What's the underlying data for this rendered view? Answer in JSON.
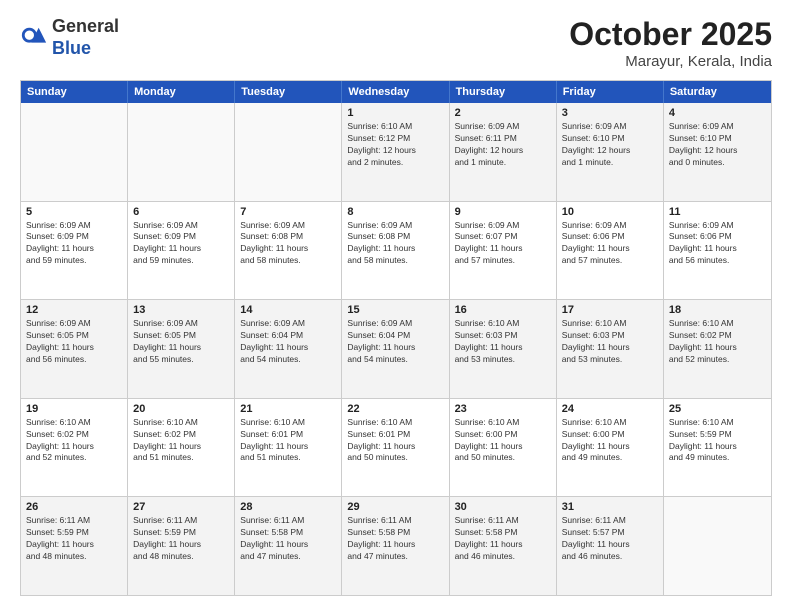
{
  "header": {
    "logo_general": "General",
    "logo_blue": "Blue",
    "month_title": "October 2025",
    "location": "Marayur, Kerala, India"
  },
  "days_of_week": [
    "Sunday",
    "Monday",
    "Tuesday",
    "Wednesday",
    "Thursday",
    "Friday",
    "Saturday"
  ],
  "weeks": [
    [
      {
        "day": "",
        "info": "",
        "empty": true
      },
      {
        "day": "",
        "info": "",
        "empty": true
      },
      {
        "day": "",
        "info": "",
        "empty": true
      },
      {
        "day": "1",
        "info": "Sunrise: 6:10 AM\nSunset: 6:12 PM\nDaylight: 12 hours\nand 2 minutes."
      },
      {
        "day": "2",
        "info": "Sunrise: 6:09 AM\nSunset: 6:11 PM\nDaylight: 12 hours\nand 1 minute."
      },
      {
        "day": "3",
        "info": "Sunrise: 6:09 AM\nSunset: 6:10 PM\nDaylight: 12 hours\nand 1 minute."
      },
      {
        "day": "4",
        "info": "Sunrise: 6:09 AM\nSunset: 6:10 PM\nDaylight: 12 hours\nand 0 minutes."
      }
    ],
    [
      {
        "day": "5",
        "info": "Sunrise: 6:09 AM\nSunset: 6:09 PM\nDaylight: 11 hours\nand 59 minutes."
      },
      {
        "day": "6",
        "info": "Sunrise: 6:09 AM\nSunset: 6:09 PM\nDaylight: 11 hours\nand 59 minutes."
      },
      {
        "day": "7",
        "info": "Sunrise: 6:09 AM\nSunset: 6:08 PM\nDaylight: 11 hours\nand 58 minutes."
      },
      {
        "day": "8",
        "info": "Sunrise: 6:09 AM\nSunset: 6:08 PM\nDaylight: 11 hours\nand 58 minutes."
      },
      {
        "day": "9",
        "info": "Sunrise: 6:09 AM\nSunset: 6:07 PM\nDaylight: 11 hours\nand 57 minutes."
      },
      {
        "day": "10",
        "info": "Sunrise: 6:09 AM\nSunset: 6:06 PM\nDaylight: 11 hours\nand 57 minutes."
      },
      {
        "day": "11",
        "info": "Sunrise: 6:09 AM\nSunset: 6:06 PM\nDaylight: 11 hours\nand 56 minutes."
      }
    ],
    [
      {
        "day": "12",
        "info": "Sunrise: 6:09 AM\nSunset: 6:05 PM\nDaylight: 11 hours\nand 56 minutes."
      },
      {
        "day": "13",
        "info": "Sunrise: 6:09 AM\nSunset: 6:05 PM\nDaylight: 11 hours\nand 55 minutes."
      },
      {
        "day": "14",
        "info": "Sunrise: 6:09 AM\nSunset: 6:04 PM\nDaylight: 11 hours\nand 54 minutes."
      },
      {
        "day": "15",
        "info": "Sunrise: 6:09 AM\nSunset: 6:04 PM\nDaylight: 11 hours\nand 54 minutes."
      },
      {
        "day": "16",
        "info": "Sunrise: 6:10 AM\nSunset: 6:03 PM\nDaylight: 11 hours\nand 53 minutes."
      },
      {
        "day": "17",
        "info": "Sunrise: 6:10 AM\nSunset: 6:03 PM\nDaylight: 11 hours\nand 53 minutes."
      },
      {
        "day": "18",
        "info": "Sunrise: 6:10 AM\nSunset: 6:02 PM\nDaylight: 11 hours\nand 52 minutes."
      }
    ],
    [
      {
        "day": "19",
        "info": "Sunrise: 6:10 AM\nSunset: 6:02 PM\nDaylight: 11 hours\nand 52 minutes."
      },
      {
        "day": "20",
        "info": "Sunrise: 6:10 AM\nSunset: 6:02 PM\nDaylight: 11 hours\nand 51 minutes."
      },
      {
        "day": "21",
        "info": "Sunrise: 6:10 AM\nSunset: 6:01 PM\nDaylight: 11 hours\nand 51 minutes."
      },
      {
        "day": "22",
        "info": "Sunrise: 6:10 AM\nSunset: 6:01 PM\nDaylight: 11 hours\nand 50 minutes."
      },
      {
        "day": "23",
        "info": "Sunrise: 6:10 AM\nSunset: 6:00 PM\nDaylight: 11 hours\nand 50 minutes."
      },
      {
        "day": "24",
        "info": "Sunrise: 6:10 AM\nSunset: 6:00 PM\nDaylight: 11 hours\nand 49 minutes."
      },
      {
        "day": "25",
        "info": "Sunrise: 6:10 AM\nSunset: 5:59 PM\nDaylight: 11 hours\nand 49 minutes."
      }
    ],
    [
      {
        "day": "26",
        "info": "Sunrise: 6:11 AM\nSunset: 5:59 PM\nDaylight: 11 hours\nand 48 minutes."
      },
      {
        "day": "27",
        "info": "Sunrise: 6:11 AM\nSunset: 5:59 PM\nDaylight: 11 hours\nand 48 minutes."
      },
      {
        "day": "28",
        "info": "Sunrise: 6:11 AM\nSunset: 5:58 PM\nDaylight: 11 hours\nand 47 minutes."
      },
      {
        "day": "29",
        "info": "Sunrise: 6:11 AM\nSunset: 5:58 PM\nDaylight: 11 hours\nand 47 minutes."
      },
      {
        "day": "30",
        "info": "Sunrise: 6:11 AM\nSunset: 5:58 PM\nDaylight: 11 hours\nand 46 minutes."
      },
      {
        "day": "31",
        "info": "Sunrise: 6:11 AM\nSunset: 5:57 PM\nDaylight: 11 hours\nand 46 minutes."
      },
      {
        "day": "",
        "info": "",
        "empty": true
      }
    ]
  ]
}
